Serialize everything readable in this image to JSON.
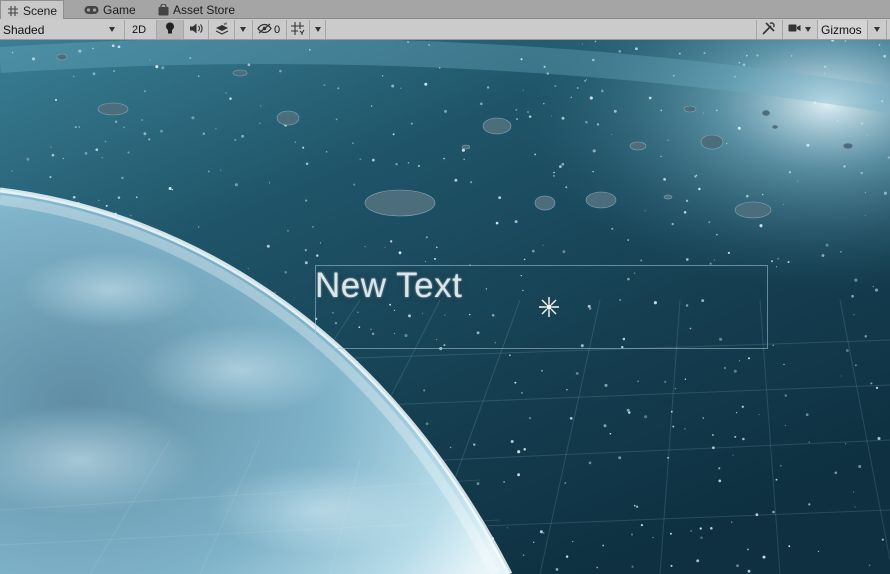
{
  "tabs": [
    {
      "label": "Scene",
      "icon": "grid-icon",
      "active": true
    },
    {
      "label": "Game",
      "icon": "gamepad-icon",
      "active": false
    },
    {
      "label": "Asset Store",
      "icon": "shopping-bag-icon",
      "active": false
    }
  ],
  "toolbar": {
    "draw_mode": "Shaded",
    "mode_2d": "2D",
    "hidden_count": "0",
    "gizmos_label": "Gizmos"
  },
  "scene": {
    "text_object": "New Text"
  },
  "colors": {
    "space_dark": "#0f2e3d",
    "space_mid": "#2f6e85",
    "planet_light": "#cde6f0",
    "toolbar_bg": "#cbcbcb",
    "tab_bg": "#a5a5a5"
  }
}
